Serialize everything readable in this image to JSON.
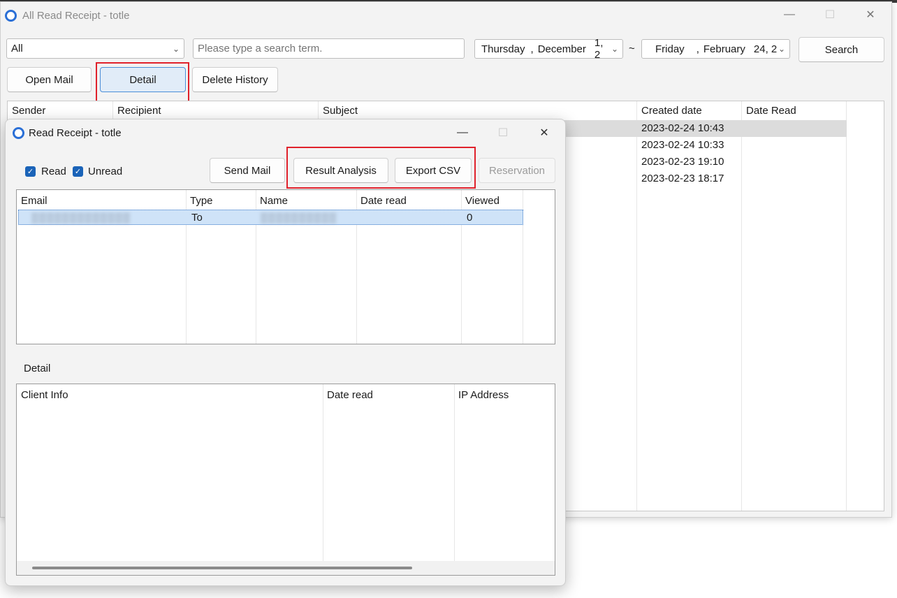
{
  "main_window": {
    "title": "All Read Receipt - totle",
    "controls": {
      "minimize": "—",
      "maximize": "☐",
      "close": "✕"
    },
    "filter": {
      "value": "All"
    },
    "search": {
      "placeholder": "Please type a search term."
    },
    "date_from": {
      "weekday": "Thursday",
      "month": "December",
      "day": "1, 2"
    },
    "date_sep": "~",
    "date_to": {
      "weekday": "Friday",
      "month": "February",
      "day": "24, 2"
    },
    "date_comma": ",",
    "search_button": "Search",
    "buttons": {
      "open_mail": "Open Mail",
      "detail": "Detail",
      "delete_history": "Delete History"
    },
    "list": {
      "columns": [
        "Sender",
        "Recipient",
        "Subject",
        "Created date",
        "Date Read"
      ],
      "created_dates": [
        "2023-02-24 10:43",
        "2023-02-24 10:33",
        "2023-02-23 19:10",
        "2023-02-23 18:17"
      ]
    }
  },
  "dialog": {
    "title": "Read Receipt - totle",
    "controls": {
      "minimize": "—",
      "maximize": "☐",
      "close": "✕"
    },
    "checkboxes": {
      "read": "Read",
      "unread": "Unread"
    },
    "buttons": {
      "send_mail": "Send Mail",
      "result_analysis": "Result Analysis",
      "export_csv": "Export CSV",
      "reservation": "Reservation"
    },
    "recipients": {
      "columns": [
        "Email",
        "Type",
        "Name",
        "Date read",
        "Viewed"
      ],
      "rows": [
        {
          "email": "▒▒▒▒▒▒▒▒▒▒▒▒▒",
          "type": "To",
          "name": "▒▒▒▒▒▒▒▒▒▒",
          "date_read": "",
          "viewed": "0"
        }
      ]
    },
    "detail_label": "Detail",
    "detail_table": {
      "columns": [
        "Client Info",
        "Date read",
        "IP Address"
      ]
    }
  },
  "colors": {
    "accent": "#2a6fd6",
    "highlight": "#e0212b",
    "selection": "#cfe3f8"
  }
}
